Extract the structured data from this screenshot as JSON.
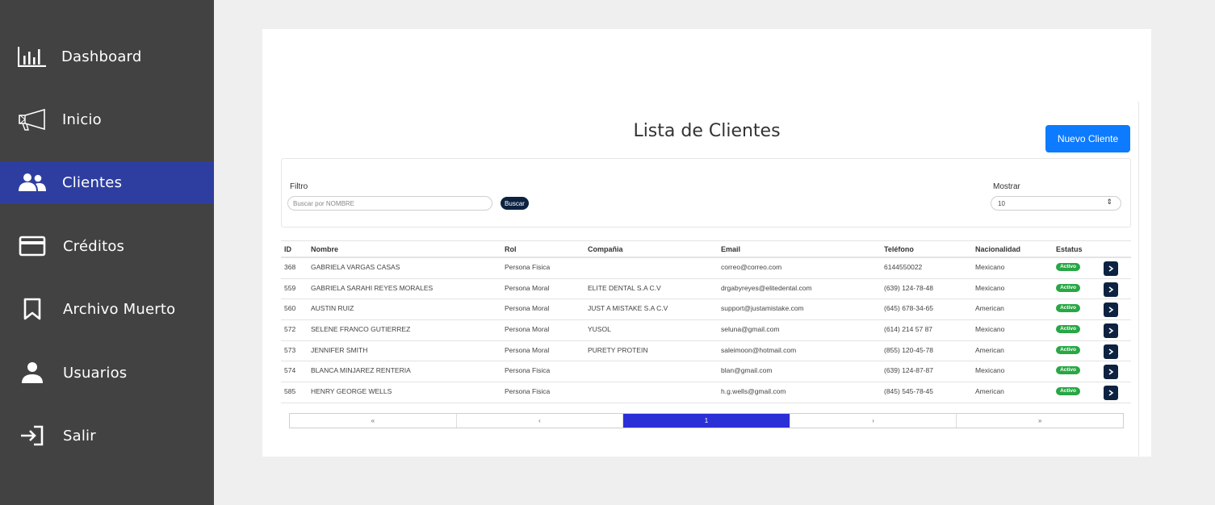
{
  "sidebar": {
    "items": [
      {
        "label": "Dashboard",
        "icon": "bar-chart-icon",
        "active": false
      },
      {
        "label": "Inicio",
        "icon": "megaphone-icon",
        "active": false
      },
      {
        "label": "Clientes",
        "icon": "people-icon",
        "active": true
      },
      {
        "label": "Créditos",
        "icon": "credit-card-icon",
        "active": false
      },
      {
        "label": "Archivo Muerto",
        "icon": "bookmark-icon",
        "active": false
      },
      {
        "label": "Usuarios",
        "icon": "person-icon",
        "active": false
      },
      {
        "label": "Salir",
        "icon": "logout-icon",
        "active": false
      }
    ]
  },
  "main": {
    "title": "Lista de Clientes",
    "new_button": "Nuevo Cliente",
    "filter": {
      "label": "Filtro",
      "placeholder": "Buscar por NOMBRE",
      "search_button": "Buscar"
    },
    "show": {
      "label": "Mostrar",
      "value": "10"
    },
    "table": {
      "headers": [
        "ID",
        "Nombre",
        "Rol",
        "Compañia",
        "Email",
        "Teléfono",
        "Nacionalidad",
        "Estatus"
      ],
      "rows": [
        {
          "id": "368",
          "nombre": "GABRIELA VARGAS CASAS",
          "rol": "Persona Fisica",
          "compania": "",
          "email": "correo@correo.com",
          "telefono": "6144550022",
          "nacionalidad": "Mexicano",
          "estatus": "Activo"
        },
        {
          "id": "559",
          "nombre": "GABRIELA SARAHI REYES MORALES",
          "rol": "Persona Moral",
          "compania": "ELITE DENTAL S.A C.V",
          "email": "drgabyreyes@elitedental.com",
          "telefono": "(639) 124-78-48",
          "nacionalidad": "Mexicano",
          "estatus": "Activo"
        },
        {
          "id": "560",
          "nombre": "AUSTIN RUIZ",
          "rol": "Persona Moral",
          "compania": "JUST A MISTAKE S.A C.V",
          "email": "support@justamistake.com",
          "telefono": "(645) 678-34-65",
          "nacionalidad": "American",
          "estatus": "Activo"
        },
        {
          "id": "572",
          "nombre": "SELENE FRANCO GUTIERREZ",
          "rol": "Persona Moral",
          "compania": "YUSOL",
          "email": "seluna@gmail.com",
          "telefono": "(614) 214 57 87",
          "nacionalidad": "Mexicano",
          "estatus": "Activo"
        },
        {
          "id": "573",
          "nombre": "JENNIFER SMITH",
          "rol": "Persona Moral",
          "compania": "PURETY PROTEIN",
          "email": "saleimoon@hotmail.com",
          "telefono": "(855) 120-45-78",
          "nacionalidad": "American",
          "estatus": "Activo"
        },
        {
          "id": "574",
          "nombre": "BLANCA MINJAREZ RENTERIA",
          "rol": "Persona Fisica",
          "compania": "",
          "email": "blan@gmail.com",
          "telefono": "(639) 124-87-87",
          "nacionalidad": "Mexicano",
          "estatus": "Activo"
        },
        {
          "id": "585",
          "nombre": "HENRY GEORGE WELLS",
          "rol": "Persona Fisica",
          "compania": "",
          "email": "h.g.wells@gmail.com",
          "telefono": "(845) 545-78-45",
          "nacionalidad": "American",
          "estatus": "Activo"
        }
      ]
    },
    "pagination": {
      "items": [
        "«",
        "‹",
        "1",
        "›",
        "»"
      ],
      "current": "1"
    }
  },
  "colors": {
    "sidebar_bg": "#424242",
    "sidebar_active": "#2e3ea0",
    "primary_button": "#0d7bff",
    "dark_button": "#0c2240",
    "status_active": "#28a745",
    "pager_active": "#2b2fd6"
  }
}
